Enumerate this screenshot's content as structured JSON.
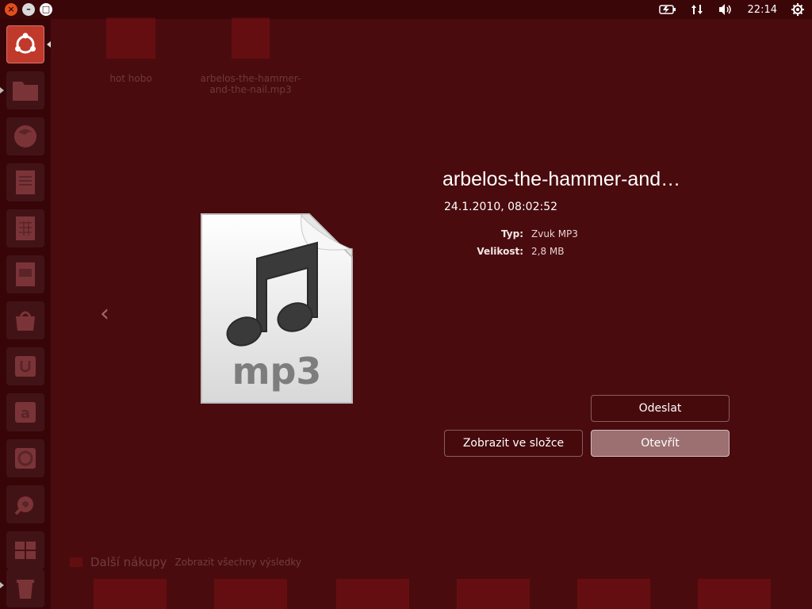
{
  "topbar": {
    "clock": "22:14",
    "icons": [
      "battery-icon",
      "network-icon",
      "volume-icon",
      "power-icon"
    ]
  },
  "launcher": {
    "items": [
      {
        "name": "dash-home-icon"
      },
      {
        "name": "files-icon"
      },
      {
        "name": "firefox-icon"
      },
      {
        "name": "writer-icon"
      },
      {
        "name": "calc-icon"
      },
      {
        "name": "impress-icon"
      },
      {
        "name": "software-center-icon"
      },
      {
        "name": "ubuntu-one-icon"
      },
      {
        "name": "amazon-icon"
      },
      {
        "name": "ubuntu-one-music-icon"
      },
      {
        "name": "system-settings-icon"
      },
      {
        "name": "workspace-switcher-icon"
      },
      {
        "name": "trash-icon"
      }
    ]
  },
  "background": {
    "results": [
      {
        "label": "hot hobo"
      },
      {
        "label": "arbelos-the-hammer-and-the-nail.mp3"
      }
    ],
    "more_apps_label": "Další nákupy",
    "more_apps_link": "Zobrazit všechny výsledky"
  },
  "preview": {
    "title": "arbelos-the-hammer-and…",
    "date": "24.1.2010, 08:02:52",
    "file_icon_text": "mp3",
    "info": [
      {
        "key": "Typ:",
        "value": "Zvuk MP3"
      },
      {
        "key": "Velikost:",
        "value": "2,8 MB"
      }
    ],
    "buttons": {
      "send": "Odeslat",
      "show_in_folder": "Zobrazit ve složce",
      "open": "Otevřít"
    },
    "prev_arrow": "‹"
  }
}
